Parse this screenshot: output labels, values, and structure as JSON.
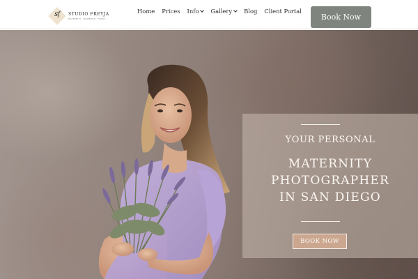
{
  "brand": {
    "initials": "sf",
    "name": "STUDIO FREYJA",
    "tagline": "MATERNITY · NEWBORN · FAMILY"
  },
  "nav": {
    "items": [
      {
        "label": "Home",
        "has_dropdown": false
      },
      {
        "label": "Prices",
        "has_dropdown": false
      },
      {
        "label": "Info",
        "has_dropdown": true
      },
      {
        "label": "Gallery",
        "has_dropdown": true
      },
      {
        "label": "Blog",
        "has_dropdown": false
      },
      {
        "label": "Client Portal",
        "has_dropdown": false
      }
    ],
    "book_label": "Book Now"
  },
  "hero": {
    "eyebrow": "YOUR PERSONAL",
    "headline_lines": [
      "MATERNITY",
      "PHOTOGRAPHER",
      "IN SAN DIEGO"
    ],
    "cta_label": "BOOK NOW",
    "photo_subject": "smiling-pregnant-woman-holding-lavender-bouquet"
  },
  "colors": {
    "header_bg": "#ffffff",
    "book_button_bg": "#7f857e",
    "cta_bg": "#cba78f",
    "panel_bg": "rgba(196,182,172,0.58)",
    "dress": "#b7a2d4",
    "lavender": "#7b6a99"
  }
}
